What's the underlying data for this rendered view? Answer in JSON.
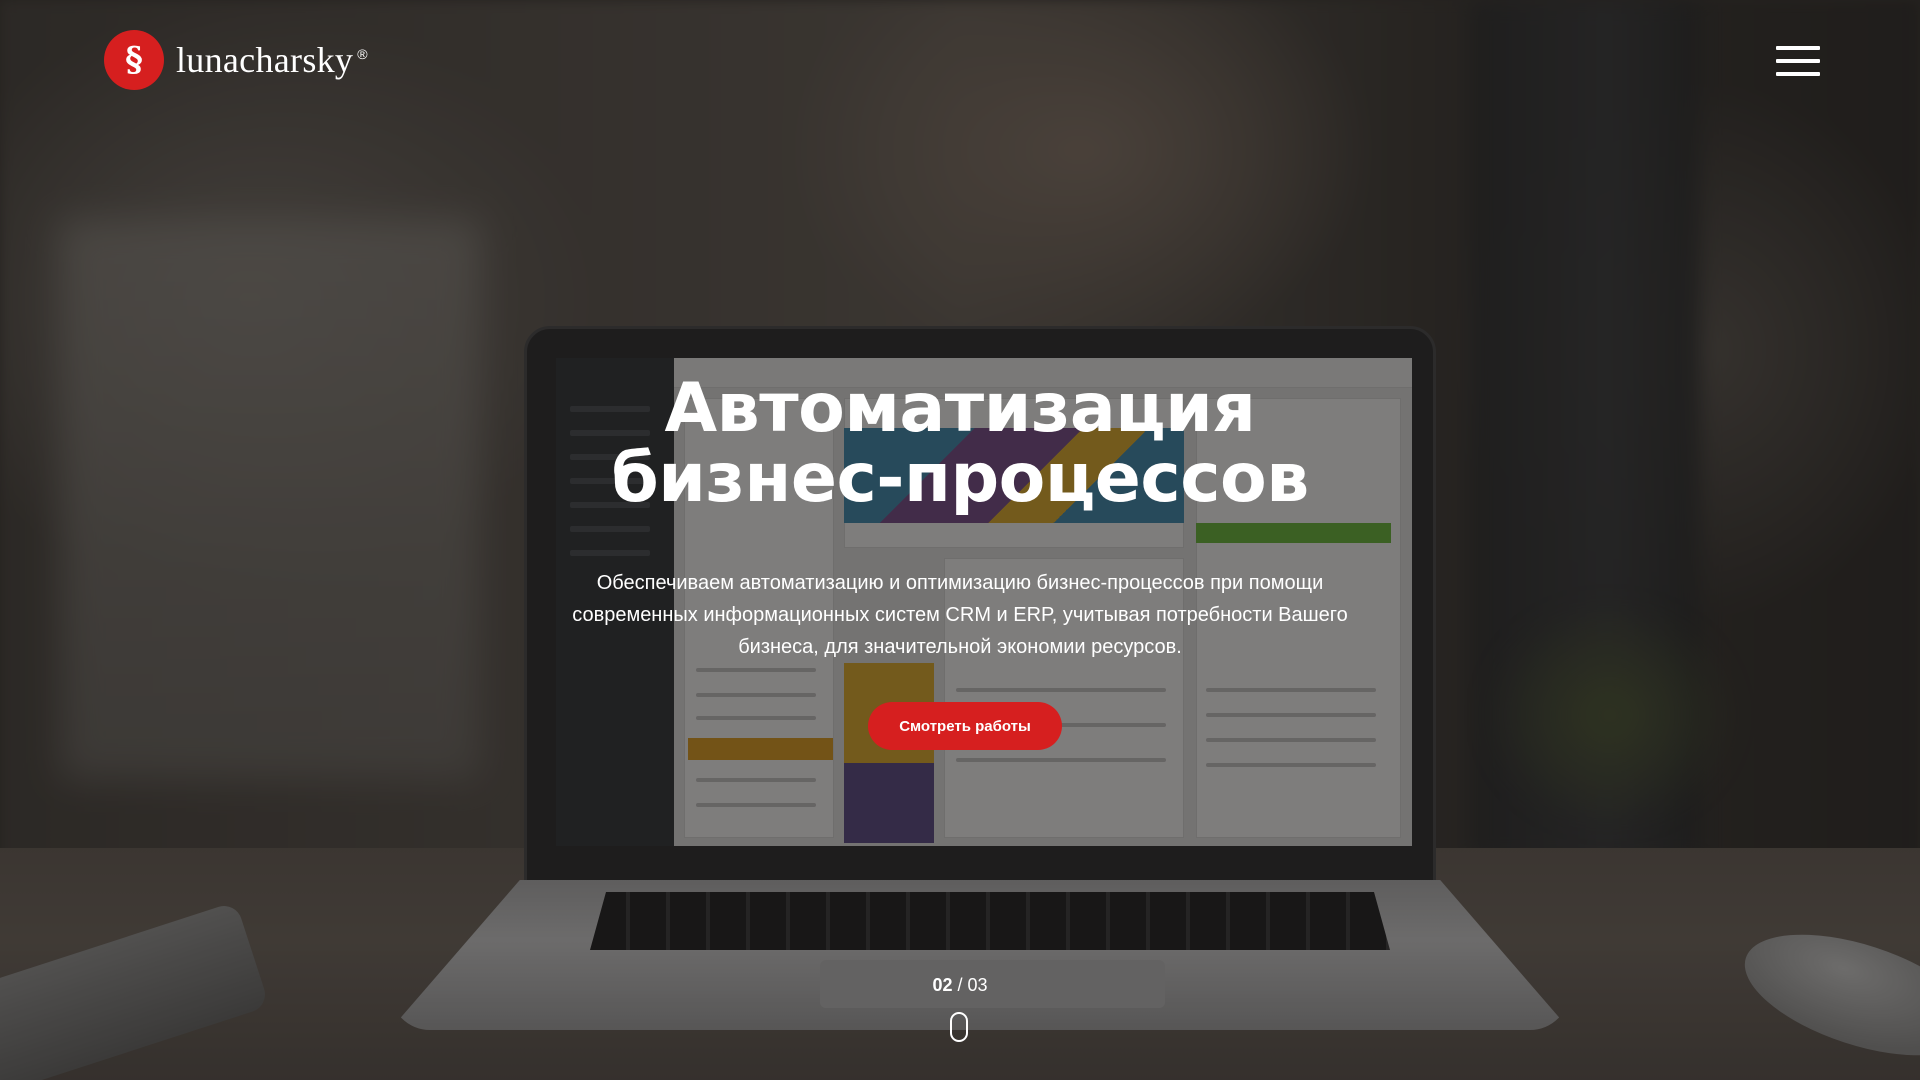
{
  "brand": {
    "logo_symbol": "§",
    "name": "lunacharsky",
    "registered_mark": "®",
    "accent_color": "#d61f1f"
  },
  "header": {
    "menu_icon": "hamburger-menu-icon"
  },
  "hero": {
    "title_line1": "Автоматизация",
    "title_line2": "бизнес-процессов",
    "subtitle": "Обеспечиваем автоматизацию и оптимизацию бизнес-процессов при помощи современных информационных систем CRM и ERP, учитывая потребности Вашего бизнеса, для значительной экономии ресурсов.",
    "cta_label": "Смотреть работы"
  },
  "slider": {
    "current": "02",
    "separator": "/",
    "total": "03",
    "scroll_icon": "mouse-scroll-icon"
  }
}
